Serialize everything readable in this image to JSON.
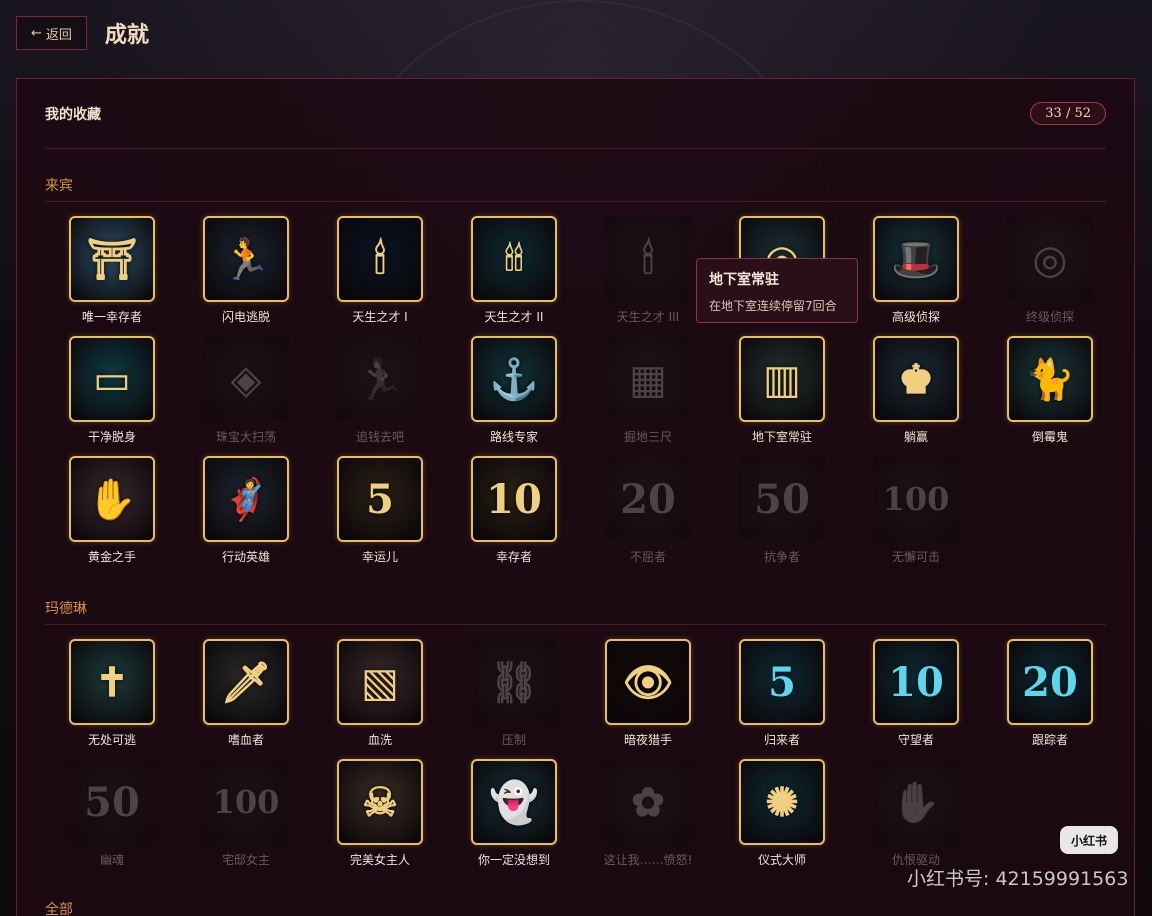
{
  "nav": {
    "back_label": "返回",
    "title": "成就"
  },
  "panel": {
    "title": "我的收藏",
    "count": "33 / 52"
  },
  "sections": [
    {
      "title": "来宾"
    },
    {
      "title": "玛德琳"
    },
    {
      "title": "全部"
    }
  ],
  "guests": [
    {
      "label": "唯一幸存者",
      "unlocked": true,
      "bg": "#2c5068",
      "glyph": "⛩",
      "icon": "doorway-figure-icon"
    },
    {
      "label": "闪电逃脱",
      "unlocked": true,
      "bg": "#1c2430",
      "glyph": "🏃",
      "icon": "running-man-icon"
    },
    {
      "label": "天生之才 I",
      "unlocked": true,
      "bg": "#0a1424",
      "glyph": "🕯",
      "icon": "one-candle-icon"
    },
    {
      "label": "天生之才 II",
      "unlocked": true,
      "bg": "#0e2a34",
      "glyph": "🕯🕯",
      "icon": "two-candles-icon"
    },
    {
      "label": "天生之才 III",
      "unlocked": false,
      "bg": "#202024",
      "glyph": "🕯",
      "icon": "three-candles-icon"
    },
    {
      "label": "地下室常驻",
      "unlocked": true,
      "bg": "#1a3036",
      "glyph": "◎",
      "icon": "magnifier-icon"
    },
    {
      "label": "高级侦探",
      "unlocked": true,
      "bg": "#173540",
      "glyph": "🎩",
      "icon": "detective-hat-icon"
    },
    {
      "label": "终级侦探",
      "unlocked": false,
      "bg": "#2a2a2a",
      "glyph": "◎",
      "icon": "detective-magnifier-icon"
    },
    {
      "label": "干净脱身",
      "unlocked": true,
      "bg": "#0f3a44",
      "glyph": "▭",
      "icon": "chest-icon"
    },
    {
      "label": "珠宝大扫荡",
      "unlocked": false,
      "bg": "#2c1e24",
      "glyph": "◈",
      "icon": "jewel-bag-icon"
    },
    {
      "label": "追钱去吧",
      "unlocked": false,
      "bg": "#2a2424",
      "glyph": "🏃",
      "icon": "money-runner-icon"
    },
    {
      "label": "路线专家",
      "unlocked": true,
      "bg": "#12343a",
      "glyph": "⚓",
      "icon": "corridor-path-icon"
    },
    {
      "label": "掘地三尺",
      "unlocked": false,
      "bg": "#2a2224",
      "glyph": "▦",
      "icon": "dig-floor-icon"
    },
    {
      "label": "地下室常驻",
      "unlocked": true,
      "bg": "#25302e",
      "glyph": "▥",
      "icon": "basement-room-icon"
    },
    {
      "label": "躺赢",
      "unlocked": true,
      "bg": "#1a2a36",
      "glyph": "♚",
      "icon": "lounging-figure-icon"
    },
    {
      "label": "倒霉鬼",
      "unlocked": true,
      "bg": "#1a3a3e",
      "glyph": "🐈",
      "icon": "black-cat-icon"
    },
    {
      "label": "黄金之手",
      "unlocked": true,
      "bg": "#3a2a30",
      "glyph": "✋",
      "icon": "gem-hand-icon"
    },
    {
      "label": "行动英雄",
      "unlocked": true,
      "bg": "#1e2630",
      "glyph": "🦸",
      "icon": "hero-silhouette-icon"
    },
    {
      "label": "幸运儿",
      "unlocked": true,
      "bg": "#2a2216",
      "glyph": "5",
      "icon": "number-5-icon"
    },
    {
      "label": "幸存者",
      "unlocked": true,
      "bg": "#2a2216",
      "glyph": "10",
      "icon": "number-10-icon"
    },
    {
      "label": "不屈者",
      "unlocked": false,
      "bg": "#2a2222",
      "glyph": "20",
      "icon": "number-20-icon"
    },
    {
      "label": "抗争者",
      "unlocked": false,
      "bg": "#2a2222",
      "glyph": "50",
      "icon": "number-50-icon"
    },
    {
      "label": "无懈可击",
      "unlocked": false,
      "bg": "#2a2222",
      "glyph": "100",
      "icon": "number-100-icon"
    }
  ],
  "madeline": [
    {
      "label": "无处可逃",
      "unlocked": true,
      "bg": "#1c3a3a",
      "glyph": "✝",
      "icon": "graveyard-icon"
    },
    {
      "label": "嗜血者",
      "unlocked": true,
      "bg": "#2a2a2a",
      "glyph": "🗡",
      "icon": "bloody-knife-icon"
    },
    {
      "label": "血洗",
      "unlocked": true,
      "bg": "#3a2a2a",
      "glyph": "▧",
      "icon": "bloody-room-icon"
    },
    {
      "label": "压制",
      "unlocked": false,
      "bg": "#2a2426",
      "glyph": "⛓",
      "icon": "bound-hands-icon"
    },
    {
      "label": "暗夜猎手",
      "unlocked": true,
      "bg": "#140a0a",
      "glyph": "👁",
      "icon": "red-eyes-icon"
    },
    {
      "label": "归来者",
      "unlocked": true,
      "bg": "#0e2a34",
      "glyph": "5",
      "icon": "teal-number-5-icon",
      "teal": true
    },
    {
      "label": "守望者",
      "unlocked": true,
      "bg": "#0e2a34",
      "glyph": "10",
      "icon": "teal-number-10-icon",
      "teal": true
    },
    {
      "label": "跟踪者",
      "unlocked": true,
      "bg": "#0e2a34",
      "glyph": "20",
      "icon": "teal-number-20-icon",
      "teal": true
    },
    {
      "label": "幽魂",
      "unlocked": false,
      "bg": "#2a2222",
      "glyph": "50",
      "icon": "ghost-number-50-icon"
    },
    {
      "label": "宅邸女主",
      "unlocked": false,
      "bg": "#2a2222",
      "glyph": "100",
      "icon": "ghost-number-100-icon"
    },
    {
      "label": "完美女主人",
      "unlocked": true,
      "bg": "#3a2e26",
      "glyph": "☠",
      "icon": "skull-table-icon"
    },
    {
      "label": "你一定没想到",
      "unlocked": true,
      "bg": "#14303a",
      "glyph": "👻",
      "icon": "ghost-woman-icon"
    },
    {
      "label": "这让我……愤怒!",
      "unlocked": false,
      "bg": "#2a2426",
      "glyph": "✿",
      "icon": "wilted-flower-icon"
    },
    {
      "label": "仪式大师",
      "unlocked": true,
      "bg": "#0e2a34",
      "glyph": "✺",
      "icon": "ritual-circle-icon"
    },
    {
      "label": "仇恨驱动",
      "unlocked": false,
      "bg": "#2a2426",
      "glyph": "✋",
      "icon": "clawing-hands-icon"
    }
  ],
  "tooltip": {
    "title": "地下室常驻",
    "desc": "在地下室连续停留7回合"
  },
  "watermark": {
    "badge": "小红书",
    "text": "小红书号: 42159991563"
  }
}
